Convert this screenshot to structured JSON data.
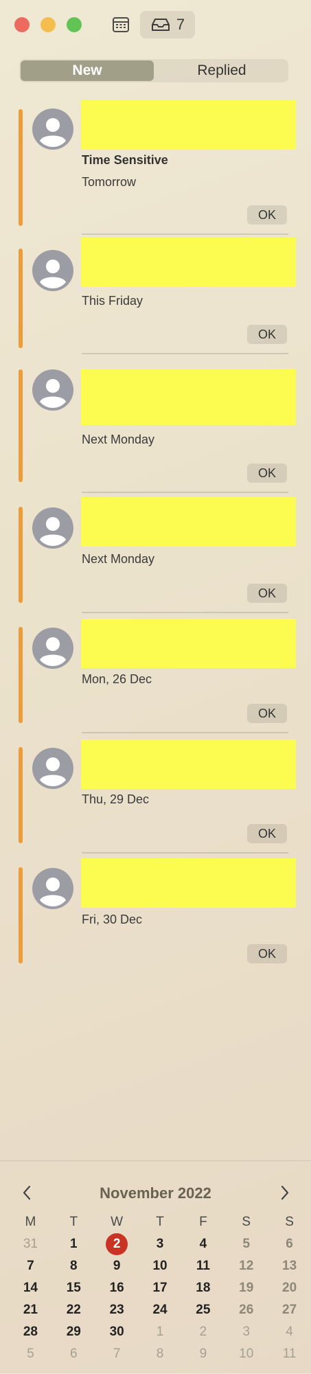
{
  "toolbar": {
    "inbox_count": "7"
  },
  "tabs": [
    {
      "label": "New",
      "selected": true
    },
    {
      "label": "Replied",
      "selected": false
    }
  ],
  "cards": [
    {
      "label": "Time Sensitive",
      "date": "Tomorrow",
      "ok": "OK"
    },
    {
      "label": "",
      "date": "This Friday",
      "ok": "OK"
    },
    {
      "label": "",
      "date": "Next Monday",
      "ok": "OK"
    },
    {
      "label": "",
      "date": "Next Monday",
      "ok": "OK"
    },
    {
      "label": "",
      "date": "Mon, 26 Dec",
      "ok": "OK"
    },
    {
      "label": "",
      "date": "Thu, 29 Dec",
      "ok": "OK"
    },
    {
      "label": "",
      "date": "Fri, 30 Dec",
      "ok": "OK"
    }
  ],
  "calendar": {
    "month_title": "November 2022",
    "weekdays": [
      "M",
      "T",
      "W",
      "T",
      "F",
      "S",
      "S"
    ],
    "weeks": [
      [
        "31",
        "1",
        "2",
        "3",
        "4",
        "5",
        "6"
      ],
      [
        "7",
        "8",
        "9",
        "10",
        "11",
        "12",
        "13"
      ],
      [
        "14",
        "15",
        "16",
        "17",
        "18",
        "19",
        "20"
      ],
      [
        "21",
        "22",
        "23",
        "24",
        "25",
        "26",
        "27"
      ],
      [
        "28",
        "29",
        "30",
        "1",
        "2",
        "3",
        "4"
      ],
      [
        "5",
        "6",
        "7",
        "8",
        "9",
        "10",
        "11"
      ]
    ],
    "today": "2"
  },
  "colors": {
    "accent_bar": "#ee9b3a",
    "highlight": "#fcfb4f",
    "today": "#c93323"
  }
}
